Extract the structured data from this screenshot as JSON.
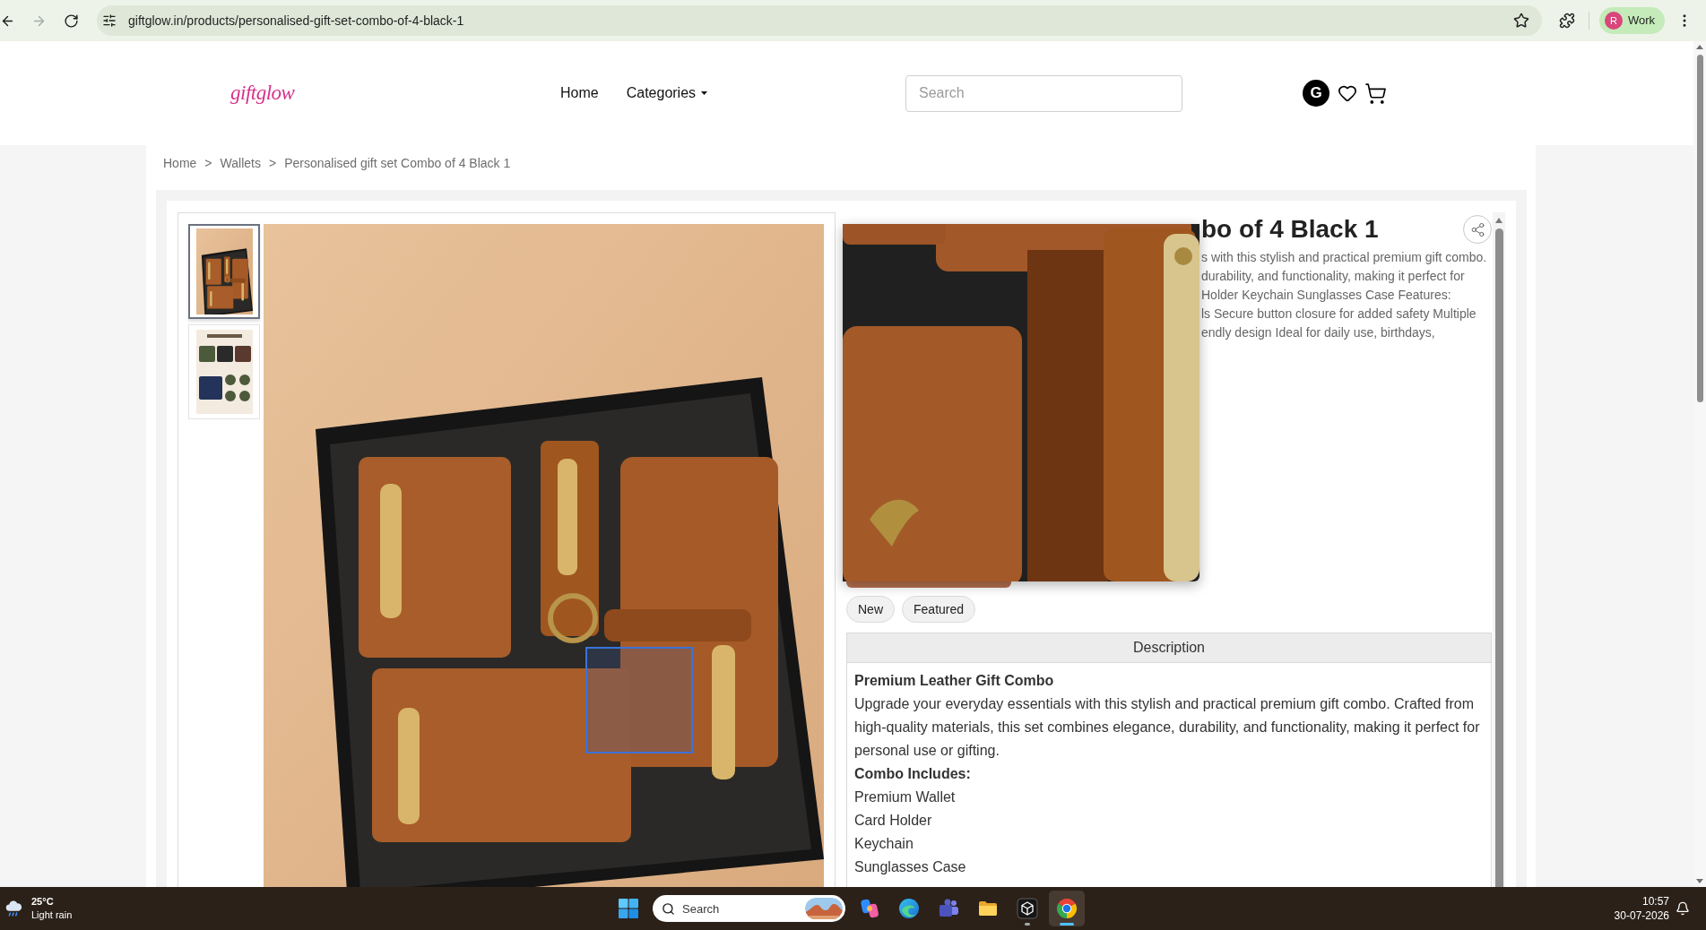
{
  "browser": {
    "nav_buttons": [
      {
        "kind": "back",
        "disabled": false
      },
      {
        "kind": "forward",
        "disabled": true
      },
      {
        "kind": "reload",
        "disabled": false
      }
    ],
    "url": "giftglow.in/products/personalised-gift-set-combo-of-4-black-1",
    "profile": {
      "initial": "R",
      "label": "Work"
    }
  },
  "header": {
    "logo": "giftglow",
    "nav": [
      {
        "label": "Home",
        "kind": "link"
      },
      {
        "label": "Categories",
        "kind": "dropdown"
      }
    ],
    "search": {
      "placeholder": "Search"
    },
    "account": {
      "initial": "G"
    }
  },
  "breadcrumb": [
    {
      "label": "Home",
      "separator": ">"
    },
    {
      "label": "Wallets",
      "separator": ">"
    },
    {
      "label": "Personalised gift set Combo of 4 Black 1"
    }
  ],
  "gallery": {
    "thumbnails": [
      {
        "selected": true
      },
      {
        "selected": false
      }
    ]
  },
  "product": {
    "title": "bo of 4 Black 1",
    "summary_lines": [
      "s with this stylish and practical premium gift combo.",
      "durability, and functionality, making it perfect for",
      "Holder Keychain Sunglasses Case Features:",
      "ls Secure button closure for added safety Multiple",
      "endly design Ideal for daily use, birthdays,"
    ],
    "tags": [
      "New",
      "Featured"
    ],
    "description": {
      "heading": "Description",
      "title": "Premium Leather Gift Combo",
      "paragraph": "Upgrade your everyday essentials with this stylish and practical premium gift combo. Crafted from high-quality materials, this set combines elegance, durability, and functionality, making it perfect for personal use or gifting.",
      "includes_heading": "Combo Includes:",
      "includes": [
        "Premium Wallet",
        "Card Holder",
        "Keychain",
        "Sunglasses Case"
      ]
    }
  },
  "taskbar": {
    "weather": {
      "temperature": "25°C",
      "condition": "Light rain"
    },
    "search": {
      "placeholder": "Search"
    },
    "apps": [
      {
        "kind": "swirl",
        "open": false,
        "active": false
      },
      {
        "kind": "wave",
        "open": false,
        "active": false
      },
      {
        "kind": "people",
        "open": false,
        "active": false
      },
      {
        "kind": "folder",
        "open": false,
        "active": false
      },
      {
        "kind": "cube",
        "open": true,
        "active": false
      },
      {
        "kind": "ring",
        "open": true,
        "active": true
      }
    ],
    "clock": {
      "time": "10:57",
      "date": "30-07-2026"
    }
  }
}
